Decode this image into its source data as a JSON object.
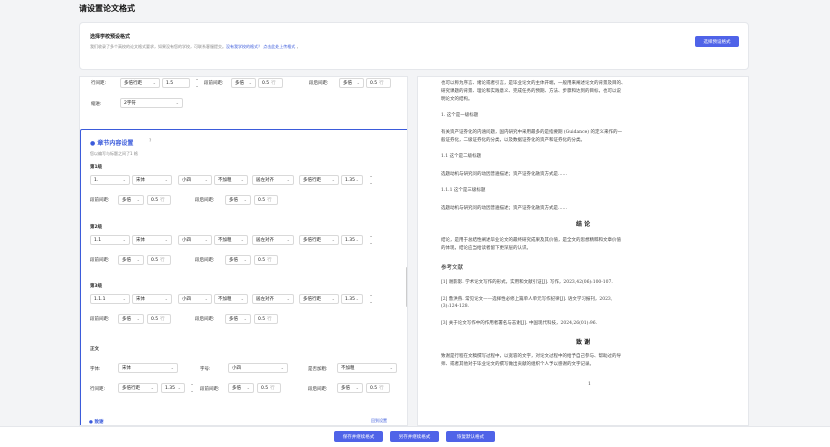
{
  "page_title": "请设置论文格式",
  "card": {
    "heading": "选择学校预设格式",
    "desc": "我们收录了多个高校的论文格式要求，如果没有您的学校，可联系客服提交。",
    "link1": "没有我学校的格式？",
    "link2": "点击此处上传格式",
    "suffix": " ，",
    "button": "选择预设格式"
  },
  "top": {
    "line_spacing_label": "行间距:",
    "line_spacing": "多倍行距",
    "line_value": "1.5",
    "before_label": "段前间距:",
    "before": "多倍",
    "before_value": "0.5",
    "after_label": "段后间距:",
    "after": "多倍",
    "after_value": "0.5",
    "unit": "行",
    "indent_label": "缩进:",
    "indent": "2字符"
  },
  "chapter": {
    "title": "● 章节内容设置",
    "help": "?",
    "subtitle": "您以编写与标题之间了1 格",
    "levels": [
      {
        "name": "第1级",
        "num": "1.",
        "font": "宋体",
        "size": "小四",
        "weight": "不加粗",
        "align": "居左对齐",
        "spacing": "多倍行距",
        "value": "1.35",
        "before_label": "段前间距:",
        "before": "多倍",
        "bv": "0.5",
        "after_label": "段后间距:",
        "after": "多倍",
        "av": "0.5"
      },
      {
        "name": "第2级",
        "num": "1.1",
        "font": "宋体",
        "size": "小四",
        "weight": "不加粗",
        "align": "居左对齐",
        "spacing": "多倍行距",
        "value": "1.35",
        "before_label": "段前间距:",
        "before": "多倍",
        "bv": "0.5",
        "after_label": "段后间距:",
        "after": "多倍",
        "av": "0.5"
      },
      {
        "name": "第3级",
        "num": "1.1.1",
        "font": "宋体",
        "size": "小四",
        "weight": "不加粗",
        "align": "居左对齐",
        "spacing": "多倍行距",
        "value": "1.35",
        "before_label": "段前间距:",
        "before": "多倍",
        "bv": "0.5",
        "after_label": "段后间距:",
        "after": "多倍",
        "av": "0.5"
      }
    ],
    "body": {
      "name": "正文",
      "font_label": "字体:",
      "font": "宋体",
      "size_label": "字号:",
      "size": "小四",
      "weight_label": "是否加粗:",
      "weight": "不加粗",
      "ls_label": "行间距:",
      "ls": "多倍行距",
      "lsv": "1.35",
      "before_label": "段前间距:",
      "before": "多倍",
      "bv": "0.5",
      "after_label": "段后间距:",
      "after": "多倍",
      "av": "0.5"
    },
    "unit": "行"
  },
  "next_section": "● 致谢",
  "restore": "回到设置",
  "doc": [
    "也可以称为序言、绪论或者引言，是毕业论文的主体开端，一般用来阐述论文的背景及目的、",
    "研究课题的背景、理论和实践意义、完成任务的预期、方法、步骤和达到的目标，也可以说",
    "明论文的结构。",
    "1. 这个是一级标题",
    "有关资产证券化的内涵问题，国内研究中采用最多的是指要期 (Guidance) 的定义来作的一",
    "般证券化，二级证券化的分类，以及数据证券化的资产和证券化的分类。",
    "1.1 这个是二级标题",
    "选题动机与研究问的动因普遍描述；资产证券化融资方式是……",
    "1.1.1 这个是三级标题",
    "选题动机与研究问的动因普遍描述；资产证券化融资方式是……",
    "结  论",
    "结论，是用于总结性阐述毕业论文的最终研究成果及其价值，是全文的思想精粹和文章价值",
    "的体现，结论应当给读者留下更深层的认识。",
    "参考文献",
    "[1] 谢影影. 学术论文写作的形式，实用和文献引证[J]. 写作，2023,42(06):100-107.",
    "[2] 鲁洪燕. 常见论文——选择性必修上篇单人单元写作纪律[J]. 语文学习报刊，2023,",
    "(3):124-128.",
    "[3] 关于论文写作中的作用者署名与志谢[J]. 中国现代科技，2024,26(01):96.",
    "致  谢",
    "致谢是行程在文稿撰写过程中，以宽容的文字，对论文过程中的给予自己参与、帮助过的导",
    "师、或者其他对于毕业论文的撰写做出贡献的组织个人予以感谢的文字记录。",
    "1"
  ],
  "footer": {
    "save": "保存并继续格式",
    "save_as": "另存并继续格式",
    "reset": "恢复默认格式"
  }
}
